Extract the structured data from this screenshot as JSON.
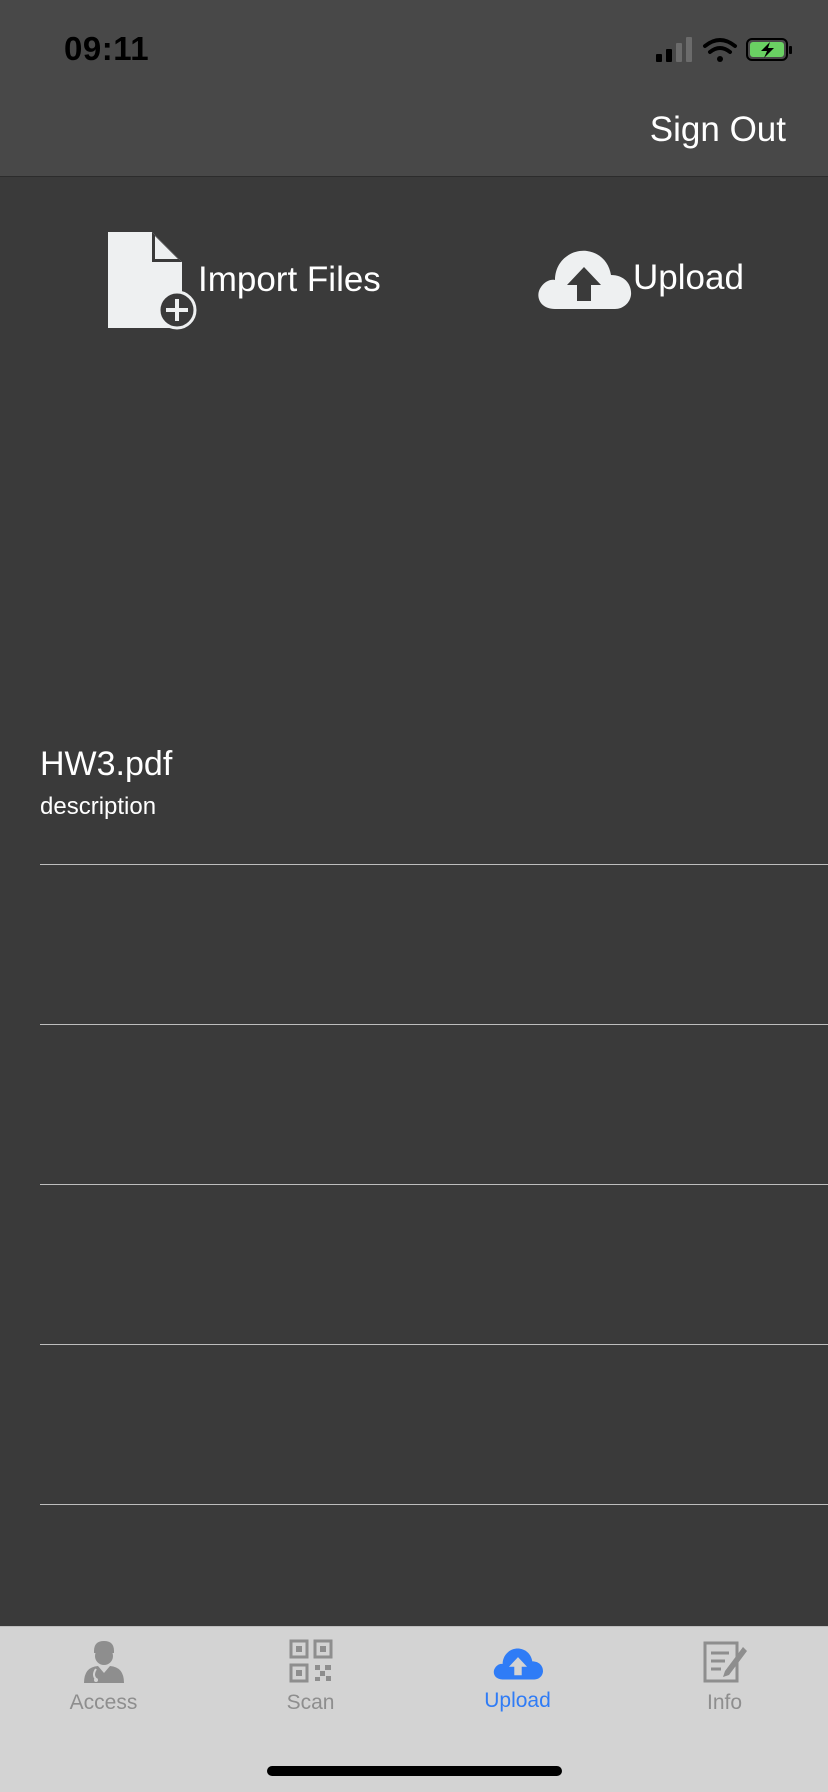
{
  "status_bar": {
    "time": "09:11"
  },
  "header": {
    "sign_out_label": "Sign Out"
  },
  "actions": {
    "import_label": "Import Files",
    "upload_label": "Upload"
  },
  "files": [
    {
      "name": "HW3.pdf",
      "description": "description"
    },
    {
      "name": "",
      "description": ""
    },
    {
      "name": "",
      "description": ""
    },
    {
      "name": "",
      "description": ""
    },
    {
      "name": "",
      "description": ""
    }
  ],
  "tabs": [
    {
      "label": "Access",
      "icon": "doctor-icon",
      "active": false
    },
    {
      "label": "Scan",
      "icon": "qr-code-icon",
      "active": false
    },
    {
      "label": "Upload",
      "icon": "cloud-upload-icon",
      "active": true
    },
    {
      "label": "Info",
      "icon": "edit-document-icon",
      "active": false
    }
  ],
  "colors": {
    "background": "#3a3a3a",
    "header": "#484848",
    "tabbar": "#d3d3d3",
    "accent": "#2f7cf6",
    "tab_inactive": "#8e8e8e",
    "battery_fill": "#6ad163"
  }
}
